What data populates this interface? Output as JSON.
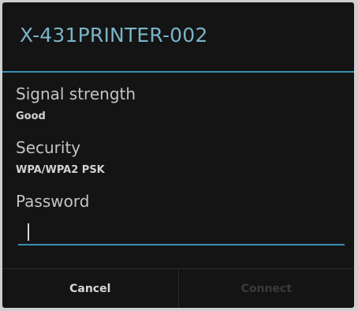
{
  "dialog": {
    "title": "X-431PRINTER-002",
    "signal_strength": {
      "label": "Signal strength",
      "value": "Good"
    },
    "security": {
      "label": "Security",
      "value": "WPA/WPA2 PSK"
    },
    "password": {
      "label": "Password",
      "value": ""
    },
    "buttons": {
      "cancel": "Cancel",
      "connect": "Connect"
    },
    "colors": {
      "accent": "#3a8fb0",
      "title": "#7ab4c8",
      "background": "#141414"
    }
  }
}
